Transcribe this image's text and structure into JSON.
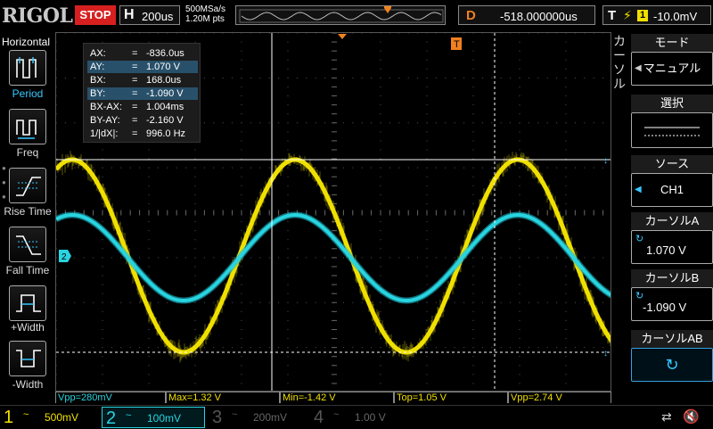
{
  "topbar": {
    "brand": "RIGOL",
    "run_state": "STOP",
    "h_label": "H",
    "timebase": "200us",
    "sample_rate": "500MSa/s",
    "memory_depth": "1.20M pts",
    "delay_label": "D",
    "delay_value": "-518.000000us",
    "trigger_label": "T",
    "trigger_source": "1",
    "trigger_level": "-10.0mV"
  },
  "leftbar": {
    "title": "Horizontal",
    "items": [
      {
        "label": "Period",
        "icon": "period-icon",
        "selected": true
      },
      {
        "label": "Freq",
        "icon": "freq-icon",
        "selected": false
      },
      {
        "label": "Rise Time",
        "icon": "rise-time-icon",
        "selected": false
      },
      {
        "label": "Fall Time",
        "icon": "fall-time-icon",
        "selected": false
      },
      {
        "label": "+Width",
        "icon": "pos-width-icon",
        "selected": false
      },
      {
        "label": "-Width",
        "icon": "neg-width-icon",
        "selected": false
      }
    ]
  },
  "readout": {
    "rows": [
      {
        "k": "AX:",
        "v": "-836.0us",
        "hl": false
      },
      {
        "k": "AY:",
        "v": "1.070 V",
        "hl": true
      },
      {
        "k": "BX:",
        "v": "168.0us",
        "hl": false
      },
      {
        "k": "BY:",
        "v": "-1.090 V",
        "hl": true
      },
      {
        "k": "BX-AX:",
        "v": "1.004ms",
        "hl": false
      },
      {
        "k": "BY-AY:",
        "v": "-2.160 V",
        "hl": false
      },
      {
        "k": "1/|dX|:",
        "v": "996.0 Hz",
        "hl": false
      }
    ],
    "eq": "="
  },
  "markers": {
    "ch2_marker": "2",
    "trig_top": "T",
    "trig_level": "T"
  },
  "measurements": [
    {
      "text": "Vpp=280mV",
      "ch": 2
    },
    {
      "text": "Max=1.32 V",
      "ch": 1
    },
    {
      "text": "Min=-1.42 V",
      "ch": 1
    },
    {
      "text": "Top=1.05 V",
      "ch": 1
    },
    {
      "text": "Vpp=2.74 V",
      "ch": 1
    }
  ],
  "rightbar": {
    "cursor_title_chars": [
      "カ",
      "ー",
      "ソ",
      "ル"
    ],
    "mode_title": "モード",
    "mode_value": "マニュアル",
    "select_title": "選択",
    "source_title": "ソース",
    "source_value": "CH1",
    "cursor_a_title": "カーソルA",
    "cursor_a_value": "1.070 V",
    "cursor_b_title": "カーソルB",
    "cursor_b_value": "-1.090 V",
    "cursor_ab_title": "カーソルAB"
  },
  "channels": [
    {
      "num": "1",
      "coupling": "~",
      "scale": "500mV",
      "color": "#f0e000",
      "active": true
    },
    {
      "num": "2",
      "coupling": "~",
      "scale": "100mV",
      "color": "#28d4e0",
      "active": true
    },
    {
      "num": "3",
      "coupling": "~",
      "scale": "200mV",
      "color": "#c0208a",
      "active": false
    },
    {
      "num": "4",
      "coupling": "~",
      "scale": "1.00 V",
      "color": "#3060e0",
      "active": false
    }
  ],
  "colors": {
    "ch1": "#f0e000",
    "ch2": "#28d4e0",
    "trigger": "#f08020",
    "highlight": "#36c8ff",
    "stop": "#d62020"
  }
}
